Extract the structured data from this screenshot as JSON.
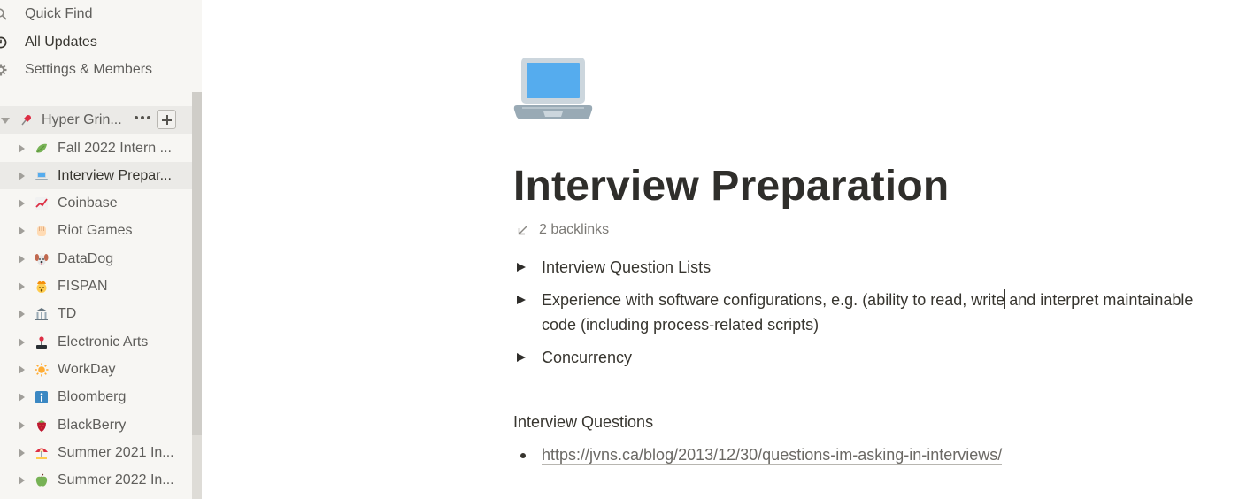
{
  "sidebar": {
    "nav": [
      {
        "label": "Quick Find",
        "icon": "search-icon"
      },
      {
        "label": "All Updates",
        "icon": "clock-icon"
      },
      {
        "label": "Settings & Members",
        "icon": "gear-icon"
      }
    ],
    "workspace": {
      "label": "Hyper Grin...",
      "icon": "pushpin-emoji"
    },
    "pages": [
      {
        "label": "Fall 2022 Intern ...",
        "icon": "leaf-emoji"
      },
      {
        "label": "Interview Prepar...",
        "icon": "laptop-emoji"
      },
      {
        "label": "Coinbase",
        "icon": "chart-increasing-emoji"
      },
      {
        "label": "Riot Games",
        "icon": "raised-fist-emoji"
      },
      {
        "label": "DataDog",
        "icon": "dog-face-emoji"
      },
      {
        "label": "FISPAN",
        "icon": "exploding-head-emoji"
      },
      {
        "label": "TD",
        "icon": "bank-emoji"
      },
      {
        "label": "Electronic Arts",
        "icon": "joystick-emoji"
      },
      {
        "label": "WorkDay",
        "icon": "sun-emoji"
      },
      {
        "label": "Bloomberg",
        "icon": "information-emoji"
      },
      {
        "label": "BlackBerry",
        "icon": "strawberry-emoji"
      },
      {
        "label": "Summer 2021 In...",
        "icon": "beach-umbrella-emoji"
      },
      {
        "label": "Summer 2022 In...",
        "icon": "green-apple-emoji"
      }
    ]
  },
  "page": {
    "icon": "laptop-emoji",
    "title": "Interview Preparation",
    "backlinks": "2 backlinks",
    "toggles": [
      {
        "before": "Interview Question Lists",
        "after": ""
      },
      {
        "before": "Experience with software configurations, e.g. (ability to read, write",
        "after": " and interpret maintainable code (including process-related scripts)"
      },
      {
        "before": "Concurrency",
        "after": ""
      }
    ],
    "section_heading": "Interview Questions",
    "links": [
      "https://jvns.ca/blog/2013/12/30/questions-im-asking-in-interviews/"
    ]
  },
  "colors": {
    "sidebar_bg": "#f7f6f3",
    "selected_bg": "#ebeae7",
    "text": "#37352f",
    "muted_text": "#5f5e5b"
  }
}
